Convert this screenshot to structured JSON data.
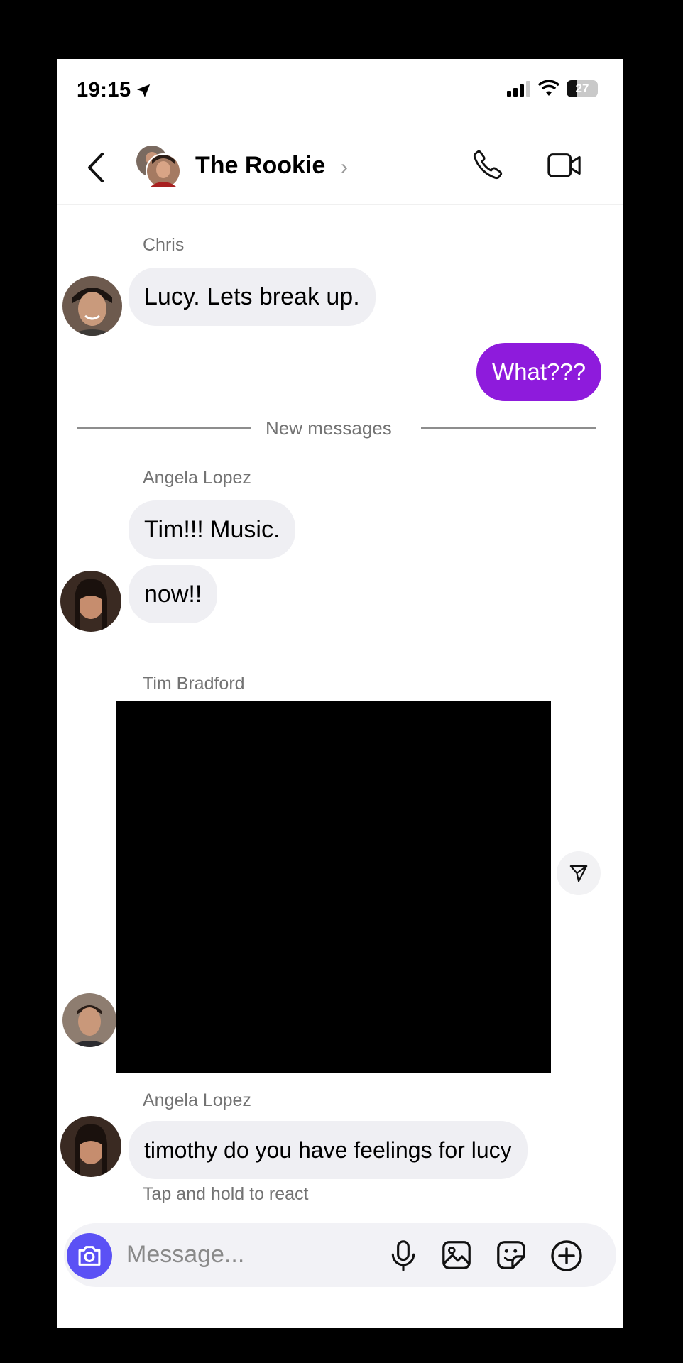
{
  "status_bar": {
    "time": "19:15",
    "battery": "27"
  },
  "header": {
    "title": "The Rookie",
    "chevron": "›"
  },
  "messages": [
    {
      "sender": "Chris",
      "text": "Lucy. Lets break up."
    },
    {
      "outgoing_text": "What???"
    },
    {
      "divider": "New messages"
    },
    {
      "sender": "Angela Lopez",
      "texts": [
        "Tim!!! Music.",
        "now!!"
      ]
    },
    {
      "sender": "Tim Bradford",
      "media": "video"
    },
    {
      "sender": "Angela Lopez",
      "text": "timothy do you have feelings for lucy"
    }
  ],
  "hint": "Tap and hold to react",
  "composer": {
    "placeholder": "Message..."
  },
  "colors": {
    "accent": "#8e1bdc",
    "camera": "#5b51f5",
    "bubble": "#efeff3"
  }
}
